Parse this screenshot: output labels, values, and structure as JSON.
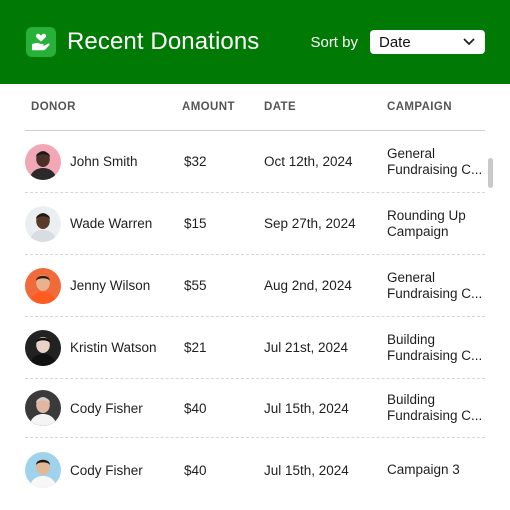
{
  "header": {
    "title": "Recent Donations",
    "sort_label": "Sort by",
    "sort_value": "Date"
  },
  "colors": {
    "header_bg": "#007a05",
    "logo_bg": "#27b13a"
  },
  "table": {
    "columns": [
      "DONOR",
      "AMOUNT",
      "DATE",
      "CAMPAIGN"
    ],
    "rows": [
      {
        "donor": "John Smith",
        "amount": "$32",
        "date": "Oct 12th, 2024",
        "campaign_line1": "General",
        "campaign_line2": "Fundraising C...",
        "avatar_bg": "#f2a7b7",
        "skin": "#4a3026",
        "shirt": "#2a2a2a",
        "hair": "#1a1a1a"
      },
      {
        "donor": "Wade Warren",
        "amount": "$15",
        "date": "Sep 27th, 2024",
        "campaign_line1": "Rounding Up",
        "campaign_line2": "Campaign",
        "avatar_bg": "#eceff2",
        "skin": "#5a3a28",
        "shirt": "#d9dde2",
        "hair": "#1a1a1a"
      },
      {
        "donor": "Jenny Wilson",
        "amount": "$55",
        "date": "Aug 2nd, 2024",
        "campaign_line1": "General",
        "campaign_line2": "Fundraising C...",
        "avatar_bg": "#f06a3a",
        "skin": "#e8b28e",
        "shirt": "#ff5a1f",
        "hair": "#3a1d12"
      },
      {
        "donor": "Kristin Watson",
        "amount": "$21",
        "date": "Jul 21st, 2024",
        "campaign_line1": "Building",
        "campaign_line2": "Fundraising C...",
        "avatar_bg": "#222222",
        "skin": "#e9d2c6",
        "shirt": "#111111",
        "hair": "#0d0d0d"
      },
      {
        "donor": "Cody Fisher",
        "amount": "$40",
        "date": "Jul 15th, 2024",
        "campaign_line1": "Building",
        "campaign_line2": "Fundraising C...",
        "avatar_bg": "#3a3a3a",
        "skin": "#e0b7a0",
        "shirt": "#f4f4f4",
        "hair": "#cfcfcf"
      },
      {
        "donor": "Cody Fisher",
        "amount": "$40",
        "date": "Jul 15th, 2024",
        "campaign_line1": "Campaign 3",
        "campaign_line2": "",
        "avatar_bg": "#9fd3ec",
        "skin": "#e3b894",
        "shirt": "#f7f7f7",
        "hair": "#1a1a1a"
      }
    ]
  }
}
